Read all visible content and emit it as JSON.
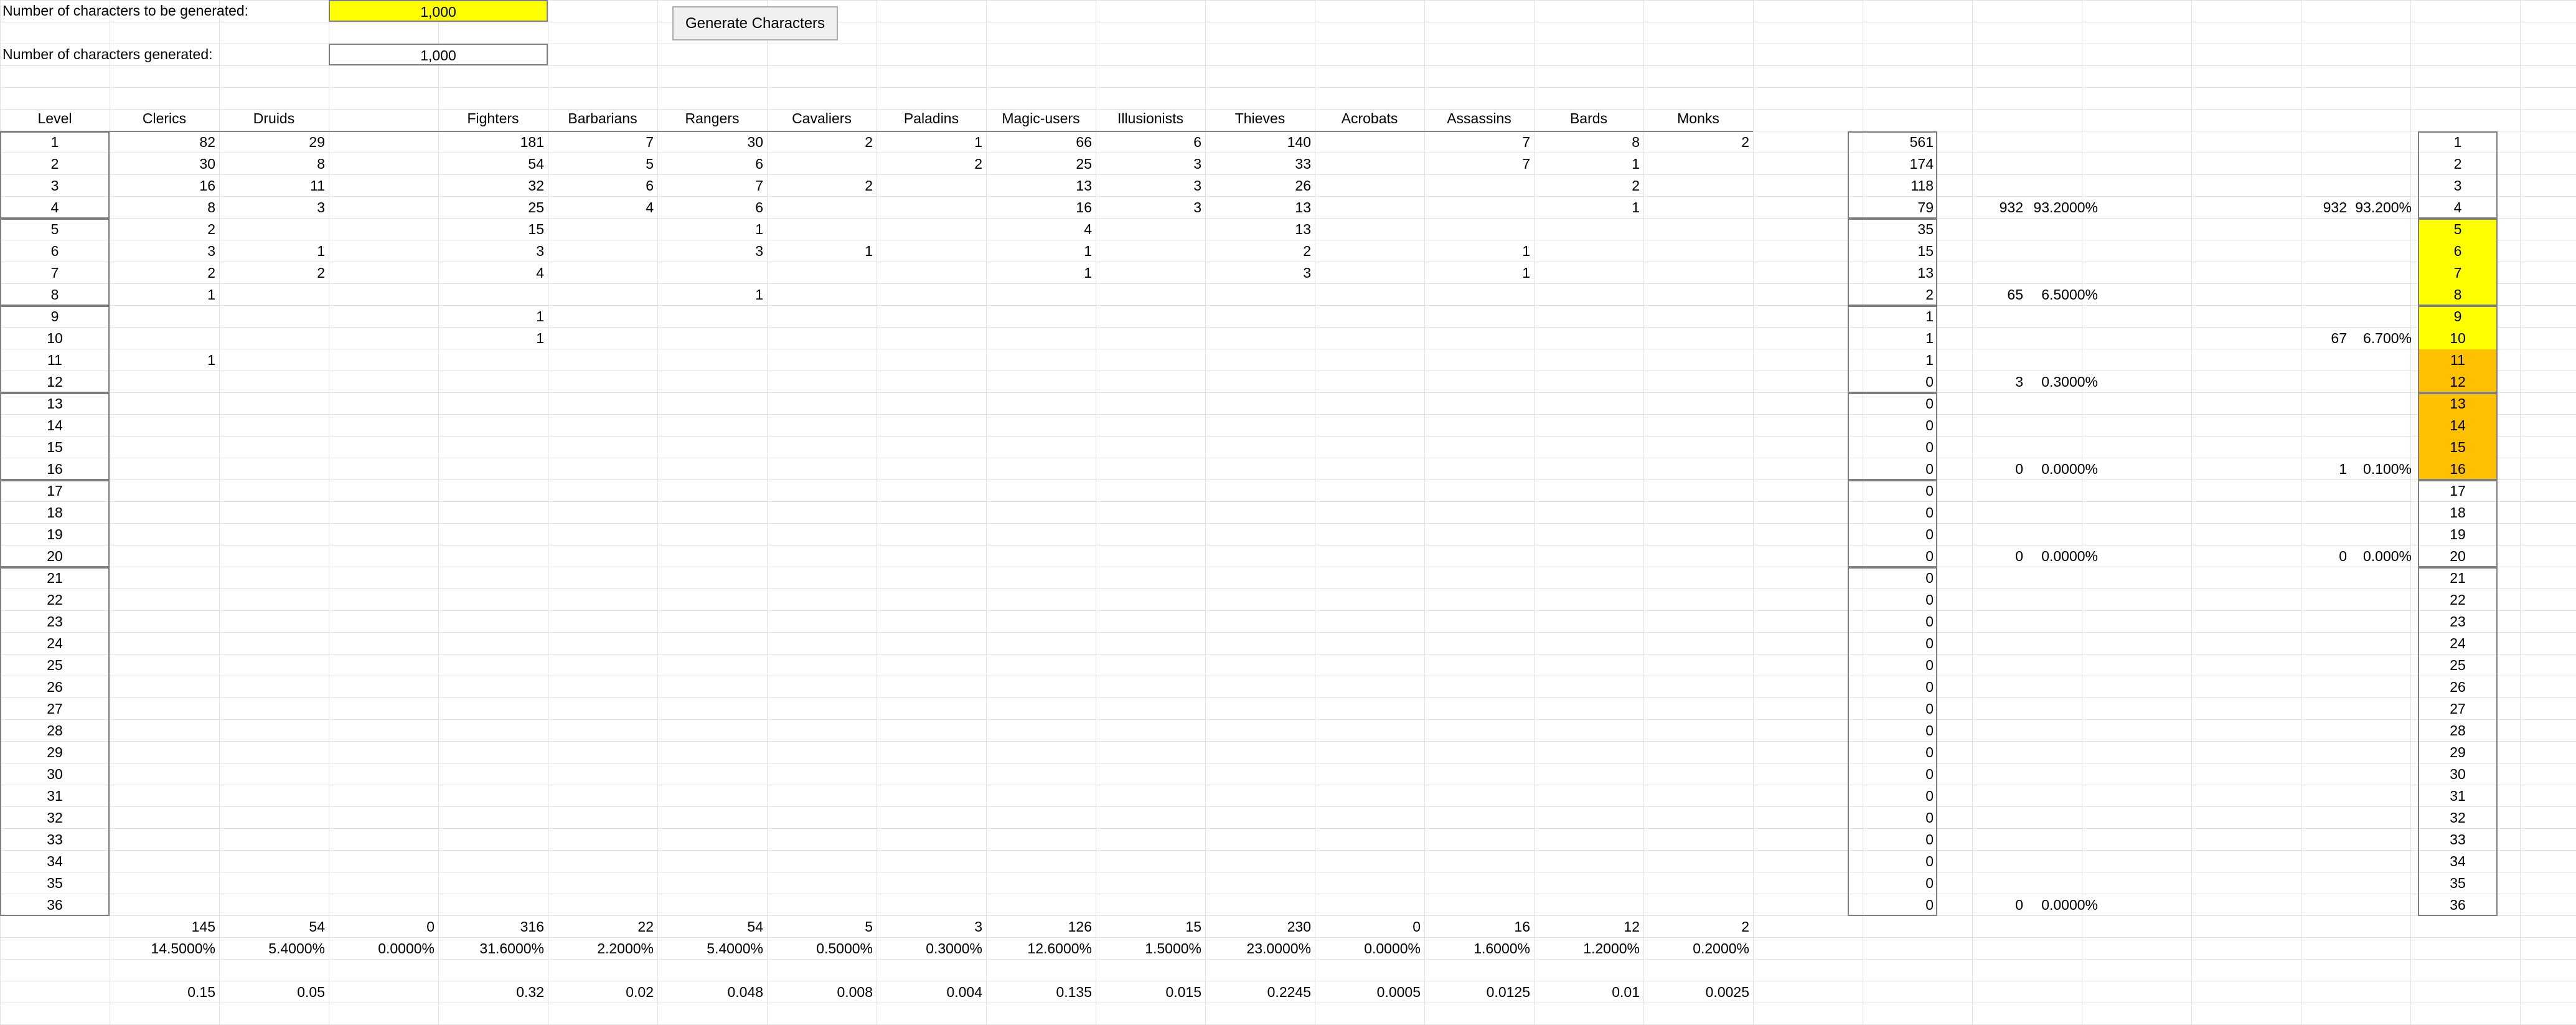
{
  "top": {
    "to_be_generated_label": "Number of characters to be generated:",
    "to_be_generated_value": "1,000",
    "generated_label": "Number of characters generated:",
    "generated_value": "1,000",
    "generate_button_label": "Generate Characters"
  },
  "colors": {
    "input_yellow": "#ffff00",
    "band_yellow": "#ffff00",
    "band_orange": "#ffc000",
    "gridline": "#e1e1e1",
    "border": "#7f7f7f"
  },
  "table": {
    "level_header": "Level",
    "class_headers": [
      "Clerics",
      "Druids",
      "",
      "Fighters",
      "Barbarians",
      "Rangers",
      "Cavaliers",
      "Paladins",
      "Magic-users",
      "Illusionists",
      "Thieves",
      "Acrobats",
      "Assassins",
      "Bards",
      "Monks"
    ],
    "rows": [
      {
        "level": "1",
        "values": [
          "82",
          "29",
          "",
          "181",
          "7",
          "30",
          "2",
          "1",
          "66",
          "6",
          "140",
          "",
          "7",
          "8",
          "2"
        ]
      },
      {
        "level": "2",
        "values": [
          "30",
          "8",
          "",
          "54",
          "5",
          "6",
          "",
          "2",
          "25",
          "3",
          "33",
          "",
          "7",
          "1",
          ""
        ]
      },
      {
        "level": "3",
        "values": [
          "16",
          "11",
          "",
          "32",
          "6",
          "7",
          "2",
          "",
          "13",
          "3",
          "26",
          "",
          "",
          "2",
          ""
        ]
      },
      {
        "level": "4",
        "values": [
          "8",
          "3",
          "",
          "25",
          "4",
          "6",
          "",
          "",
          "16",
          "3",
          "13",
          "",
          "",
          "1",
          ""
        ]
      },
      {
        "level": "5",
        "values": [
          "2",
          "",
          "",
          "15",
          "",
          "1",
          "",
          "",
          "4",
          "",
          "13",
          "",
          "",
          "",
          ""
        ]
      },
      {
        "level": "6",
        "values": [
          "3",
          "1",
          "",
          "3",
          "",
          "3",
          "1",
          "",
          "1",
          "",
          "2",
          "",
          "1",
          "",
          ""
        ]
      },
      {
        "level": "7",
        "values": [
          "2",
          "2",
          "",
          "4",
          "",
          "",
          "",
          "",
          "1",
          "",
          "3",
          "",
          "1",
          "",
          ""
        ]
      },
      {
        "level": "8",
        "values": [
          "1",
          "",
          "",
          "",
          "",
          "1",
          "",
          "",
          "",
          "",
          "",
          "",
          "",
          "",
          ""
        ]
      },
      {
        "level": "9",
        "values": [
          "",
          "",
          "",
          "1",
          "",
          "",
          "",
          "",
          "",
          "",
          "",
          "",
          "",
          "",
          ""
        ]
      },
      {
        "level": "10",
        "values": [
          "",
          "",
          "",
          "1",
          "",
          "",
          "",
          "",
          "",
          "",
          "",
          "",
          "",
          "",
          ""
        ]
      },
      {
        "level": "11",
        "values": [
          "1",
          "",
          "",
          "",
          "",
          "",
          "",
          "",
          "",
          "",
          "",
          "",
          "",
          "",
          ""
        ]
      },
      {
        "level": "12",
        "values": [
          "",
          "",
          "",
          "",
          "",
          "",
          "",
          "",
          "",
          "",
          "",
          "",
          "",
          "",
          ""
        ]
      },
      {
        "level": "13",
        "values": [
          "",
          "",
          "",
          "",
          "",
          "",
          "",
          "",
          "",
          "",
          "",
          "",
          "",
          "",
          ""
        ]
      },
      {
        "level": "14",
        "values": [
          "",
          "",
          "",
          "",
          "",
          "",
          "",
          "",
          "",
          "",
          "",
          "",
          "",
          "",
          ""
        ]
      },
      {
        "level": "15",
        "values": [
          "",
          "",
          "",
          "",
          "",
          "",
          "",
          "",
          "",
          "",
          "",
          "",
          "",
          "",
          ""
        ]
      },
      {
        "level": "16",
        "values": [
          "",
          "",
          "",
          "",
          "",
          "",
          "",
          "",
          "",
          "",
          "",
          "",
          "",
          "",
          ""
        ]
      },
      {
        "level": "17",
        "values": [
          "",
          "",
          "",
          "",
          "",
          "",
          "",
          "",
          "",
          "",
          "",
          "",
          "",
          "",
          ""
        ]
      },
      {
        "level": "18",
        "values": [
          "",
          "",
          "",
          "",
          "",
          "",
          "",
          "",
          "",
          "",
          "",
          "",
          "",
          "",
          ""
        ]
      },
      {
        "level": "19",
        "values": [
          "",
          "",
          "",
          "",
          "",
          "",
          "",
          "",
          "",
          "",
          "",
          "",
          "",
          "",
          ""
        ]
      },
      {
        "level": "20",
        "values": [
          "",
          "",
          "",
          "",
          "",
          "",
          "",
          "",
          "",
          "",
          "",
          "",
          "",
          "",
          ""
        ]
      },
      {
        "level": "21",
        "values": [
          "",
          "",
          "",
          "",
          "",
          "",
          "",
          "",
          "",
          "",
          "",
          "",
          "",
          "",
          ""
        ]
      },
      {
        "level": "22",
        "values": [
          "",
          "",
          "",
          "",
          "",
          "",
          "",
          "",
          "",
          "",
          "",
          "",
          "",
          "",
          ""
        ]
      },
      {
        "level": "23",
        "values": [
          "",
          "",
          "",
          "",
          "",
          "",
          "",
          "",
          "",
          "",
          "",
          "",
          "",
          "",
          ""
        ]
      },
      {
        "level": "24",
        "values": [
          "",
          "",
          "",
          "",
          "",
          "",
          "",
          "",
          "",
          "",
          "",
          "",
          "",
          "",
          ""
        ]
      },
      {
        "level": "25",
        "values": [
          "",
          "",
          "",
          "",
          "",
          "",
          "",
          "",
          "",
          "",
          "",
          "",
          "",
          "",
          ""
        ]
      },
      {
        "level": "26",
        "values": [
          "",
          "",
          "",
          "",
          "",
          "",
          "",
          "",
          "",
          "",
          "",
          "",
          "",
          "",
          ""
        ]
      },
      {
        "level": "27",
        "values": [
          "",
          "",
          "",
          "",
          "",
          "",
          "",
          "",
          "",
          "",
          "",
          "",
          "",
          "",
          ""
        ]
      },
      {
        "level": "28",
        "values": [
          "",
          "",
          "",
          "",
          "",
          "",
          "",
          "",
          "",
          "",
          "",
          "",
          "",
          "",
          ""
        ]
      },
      {
        "level": "29",
        "values": [
          "",
          "",
          "",
          "",
          "",
          "",
          "",
          "",
          "",
          "",
          "",
          "",
          "",
          "",
          ""
        ]
      },
      {
        "level": "30",
        "values": [
          "",
          "",
          "",
          "",
          "",
          "",
          "",
          "",
          "",
          "",
          "",
          "",
          "",
          "",
          ""
        ]
      },
      {
        "level": "31",
        "values": [
          "",
          "",
          "",
          "",
          "",
          "",
          "",
          "",
          "",
          "",
          "",
          "",
          "",
          "",
          ""
        ]
      },
      {
        "level": "32",
        "values": [
          "",
          "",
          "",
          "",
          "",
          "",
          "",
          "",
          "",
          "",
          "",
          "",
          "",
          "",
          ""
        ]
      },
      {
        "level": "33",
        "values": [
          "",
          "",
          "",
          "",
          "",
          "",
          "",
          "",
          "",
          "",
          "",
          "",
          "",
          "",
          ""
        ]
      },
      {
        "level": "34",
        "values": [
          "",
          "",
          "",
          "",
          "",
          "",
          "",
          "",
          "",
          "",
          "",
          "",
          "",
          "",
          ""
        ]
      },
      {
        "level": "35",
        "values": [
          "",
          "",
          "",
          "",
          "",
          "",
          "",
          "",
          "",
          "",
          "",
          "",
          "",
          "",
          ""
        ]
      },
      {
        "level": "36",
        "values": [
          "",
          "",
          "",
          "",
          "",
          "",
          "",
          "",
          "",
          "",
          "",
          "",
          "",
          "",
          ""
        ]
      }
    ],
    "totals": [
      "145",
      "54",
      "0",
      "316",
      "22",
      "54",
      "5",
      "3",
      "126",
      "15",
      "230",
      "0",
      "16",
      "12",
      "2"
    ],
    "percents": [
      "14.5000%",
      "5.4000%",
      "0.0000%",
      "31.6000%",
      "2.2000%",
      "5.4000%",
      "0.5000%",
      "0.3000%",
      "12.6000%",
      "1.5000%",
      "23.0000%",
      "0.0000%",
      "1.6000%",
      "1.2000%",
      "0.2000%"
    ],
    "ratios": [
      "0.15",
      "0.05",
      "",
      "0.32",
      "0.02",
      "0.048",
      "0.008",
      "0.004",
      "0.135",
      "0.015",
      "0.2245",
      "0.0005",
      "0.0125",
      "0.01",
      "0.0025"
    ]
  },
  "summary": {
    "level_totals": [
      "561",
      "174",
      "118",
      "79",
      "35",
      "15",
      "13",
      "2",
      "1",
      "1",
      "1",
      "0",
      "0",
      "0",
      "0",
      "0",
      "0",
      "0",
      "0",
      "0",
      "0",
      "0",
      "0",
      "0",
      "0",
      "0",
      "0",
      "0",
      "0",
      "0",
      "0",
      "0",
      "0",
      "0",
      "0",
      "0"
    ],
    "group_a": [
      {
        "row": 4,
        "count": "932",
        "pct": "93.2000%"
      },
      {
        "row": 8,
        "count": "65",
        "pct": "6.5000%"
      },
      {
        "row": 12,
        "count": "3",
        "pct": "0.3000%"
      },
      {
        "row": 16,
        "count": "0",
        "pct": "0.0000%"
      },
      {
        "row": 20,
        "count": "0",
        "pct": "0.0000%"
      },
      {
        "row": 36,
        "count": "0",
        "pct": "0.0000%"
      }
    ],
    "group_b": [
      {
        "row": 4,
        "count": "932",
        "pct": "93.200%"
      },
      {
        "row": 10,
        "count": "67",
        "pct": "6.700%"
      },
      {
        "row": 16,
        "count": "1",
        "pct": "0.100%"
      },
      {
        "row": 20,
        "count": "0",
        "pct": "0.000%"
      }
    ],
    "right_levels": [
      "1",
      "2",
      "3",
      "4",
      "5",
      "6",
      "7",
      "8",
      "9",
      "10",
      "11",
      "12",
      "13",
      "14",
      "15",
      "16",
      "17",
      "18",
      "19",
      "20",
      "21",
      "22",
      "23",
      "24",
      "25",
      "26",
      "27",
      "28",
      "29",
      "30",
      "31",
      "32",
      "33",
      "34",
      "35",
      "36"
    ],
    "yellow_levels": [
      "5",
      "6",
      "7",
      "8",
      "9",
      "10"
    ],
    "orange_levels": [
      "11",
      "12",
      "13",
      "14",
      "15",
      "16"
    ]
  }
}
